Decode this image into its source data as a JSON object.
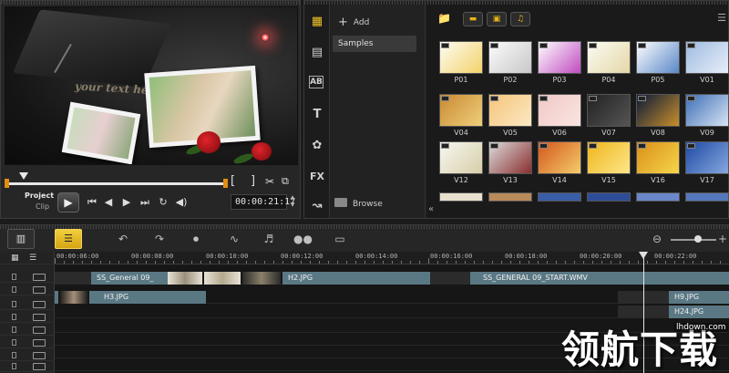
{
  "player": {
    "preview_text": "your text here",
    "mode_project": "Project",
    "mode_clip": "Clip",
    "timecode": "00:00:21:17",
    "bracket_in": "[",
    "bracket_out": "]"
  },
  "library": {
    "add_label": "Add",
    "folders": [
      "Samples"
    ],
    "browse_label": "Browse",
    "filters": [
      "video-filter",
      "photo-filter",
      "audio-filter"
    ],
    "thumbs": [
      {
        "label": "P01",
        "colors": [
          "#fdfcf4",
          "#f3d36a"
        ]
      },
      {
        "label": "P02",
        "colors": [
          "#fbfbfb",
          "#c8c8c8"
        ]
      },
      {
        "label": "P03",
        "colors": [
          "#ffffff",
          "#c04cc0"
        ]
      },
      {
        "label": "P04",
        "colors": [
          "#fbfbf3",
          "#e5d7a8"
        ]
      },
      {
        "label": "P05",
        "colors": [
          "#ffffff",
          "#5a87c9"
        ]
      },
      {
        "label": "V01",
        "colors": [
          "#9fbbe0",
          "#e7eef9"
        ]
      },
      {
        "label": "V04",
        "colors": [
          "#c98a32",
          "#efcf7c"
        ]
      },
      {
        "label": "V05",
        "colors": [
          "#f5c57a",
          "#fbe8c4"
        ]
      },
      {
        "label": "V06",
        "colors": [
          "#f0c8c6",
          "#fae5e1"
        ]
      },
      {
        "label": "V07",
        "colors": [
          "#222222",
          "#555555"
        ]
      },
      {
        "label": "V08",
        "colors": [
          "#0a1a3a",
          "#c98f2a"
        ]
      },
      {
        "label": "V09",
        "colors": [
          "#3e6fb8",
          "#d7e4f2"
        ]
      },
      {
        "label": "V12",
        "colors": [
          "#f7f7f2",
          "#d7cfa8"
        ]
      },
      {
        "label": "V13",
        "colors": [
          "#dcdcdc",
          "#8a2f2f"
        ]
      },
      {
        "label": "V14",
        "colors": [
          "#d4571d",
          "#f4cc6b"
        ]
      },
      {
        "label": "V15",
        "colors": [
          "#f0b51c",
          "#fde78a"
        ]
      },
      {
        "label": "V16",
        "colors": [
          "#d98f19",
          "#f6d64a"
        ]
      },
      {
        "label": "V17",
        "colors": [
          "#1f4aa3",
          "#86a8df"
        ]
      }
    ]
  },
  "timeline": {
    "ruler": [
      "00:00:06:00",
      "00:00:08:00",
      "00:00:10:00",
      "00:00:12:00",
      "00:00:14:00",
      "00:00:16:00",
      "00:00:18:00",
      "00:00:20:00",
      "00:00:22:00"
    ],
    "clips": {
      "ss_general_left": "SS_General 09_",
      "h2": "H2.JPG",
      "ss_general_right": "SS_GENERAL 09_START.WMV",
      "h3": "H3.JPG",
      "h9": "H9.JPG",
      "h24": "H24.JPG"
    }
  },
  "watermark": {
    "text": "领航下载",
    "url": "lhdown.com"
  },
  "colors": {
    "accent_yellow": "#e8b417",
    "trim_orange": "#e38d12",
    "clip_blue": "#5a7884"
  }
}
